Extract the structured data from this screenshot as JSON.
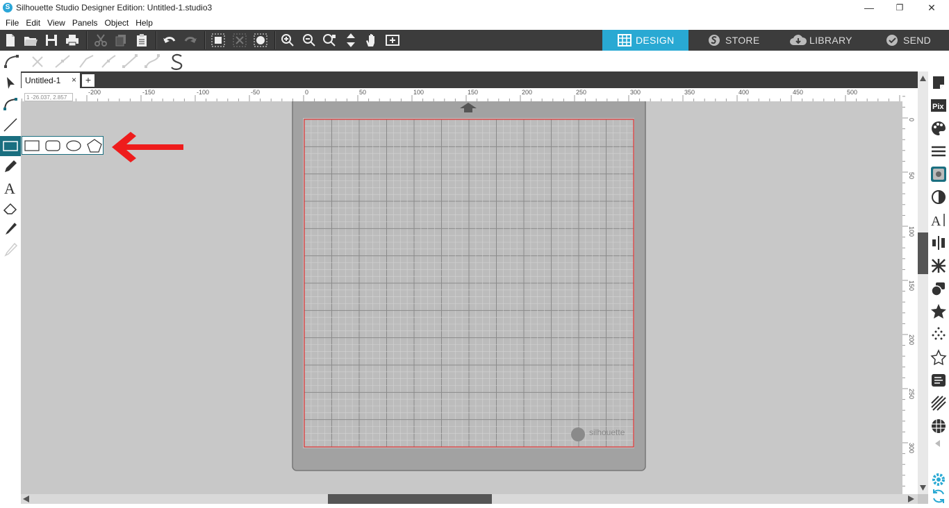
{
  "window": {
    "title": "Silhouette Studio Designer Edition: Untitled-1.studio3",
    "logo_glyph": "S",
    "minimize": "—",
    "restore": "❐",
    "close": "✕"
  },
  "menu": [
    "File",
    "Edit",
    "View",
    "Panels",
    "Object",
    "Help"
  ],
  "nav_tabs": [
    {
      "label": "DESIGN",
      "icon": "grid-icon",
      "active": true
    },
    {
      "label": "STORE",
      "icon": "silhouette-s-icon",
      "active": false
    },
    {
      "label": "LIBRARY",
      "icon": "cloud-download-icon",
      "active": false
    },
    {
      "label": "SEND",
      "icon": "checkmark-icon",
      "active": false
    }
  ],
  "document": {
    "tab_title": "Untitled-1",
    "tab_close": "×",
    "add_tab": "+"
  },
  "coordinates": "1  -26.037, 2.857",
  "ruler_h_labels": [
    "-200",
    "-150",
    "-100",
    "-50",
    "0",
    "50",
    "100",
    "150",
    "200",
    "250",
    "300",
    "350",
    "400",
    "450",
    "500"
  ],
  "ruler_v_labels": [
    "0",
    "50",
    "100",
    "150",
    "200",
    "250",
    "300"
  ],
  "mat": {
    "brand": "silhouette"
  },
  "colors": {
    "toolbar_bg": "#3c3c3c",
    "active_tab": "#29a9d3",
    "cut_border": "#e03030",
    "arrow": "#ee1c1c",
    "flyout_border": "#1a6f80"
  }
}
